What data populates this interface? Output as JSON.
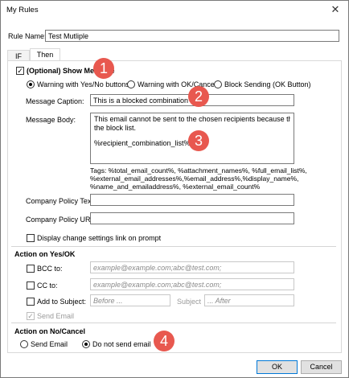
{
  "window": {
    "title": "My Rules",
    "close_glyph": "✕"
  },
  "rule_name": {
    "label": "Rule Name:",
    "value": "Test Mutliple"
  },
  "tabs": [
    {
      "label": "IF"
    },
    {
      "label": "Then"
    }
  ],
  "show_message": {
    "label": "(Optional) Show Message",
    "checked": true
  },
  "message_type": {
    "options": [
      {
        "label": "Warning with Yes/No buttons",
        "selected": true
      },
      {
        "label": "Warning with OK/Cancel",
        "selected": false
      },
      {
        "label": "Block Sending (OK Button)",
        "selected": false
      }
    ]
  },
  "message_caption": {
    "label": "Message Caption:",
    "value": "This is a blocked combination"
  },
  "message_body": {
    "label": "Message Body:",
    "line1": "This email cannot be sent to the chosen recipients because they are on",
    "line2": "the block list.",
    "line3": "%recipient_combination_list%"
  },
  "tags": {
    "line1": "Tags: %total_email_count%, %attachment_names%, %full_email_list%,",
    "line2": "%external_email_addresses%,%email_address%,%display_name%,",
    "line3": "%name_and_emailaddress%, %external_email_count%"
  },
  "company_policy_text": {
    "label": "Company Policy Text:",
    "value": ""
  },
  "company_policy_url": {
    "label": "Company Policy URL:",
    "value": ""
  },
  "display_change": {
    "label": "Display change settings link on prompt",
    "checked": false
  },
  "action_yes": {
    "heading": "Action on Yes/OK",
    "bcc": {
      "label": "BCC to:",
      "placeholder": "example@example.com;abc@test.com;"
    },
    "cc": {
      "label": "CC to:",
      "placeholder": "example@example.com;abc@test.com;"
    },
    "subject": {
      "label": "Add to Subject:",
      "before_placeholder": "Before ...",
      "mid_label": "Subject",
      "after_placeholder": "... After"
    },
    "send_email": {
      "label": "Send Email",
      "checked": true
    }
  },
  "action_no": {
    "heading": "Action on No/Cancel",
    "options": [
      {
        "label": "Send Email",
        "selected": false
      },
      {
        "label": "Do not send email",
        "selected": true
      }
    ]
  },
  "buttons": {
    "ok": "OK",
    "cancel": "Cancel"
  },
  "callouts": [
    "1",
    "2",
    "3",
    "4"
  ],
  "colors": {
    "callout": "#e8584f",
    "accent": "#0078d7"
  }
}
